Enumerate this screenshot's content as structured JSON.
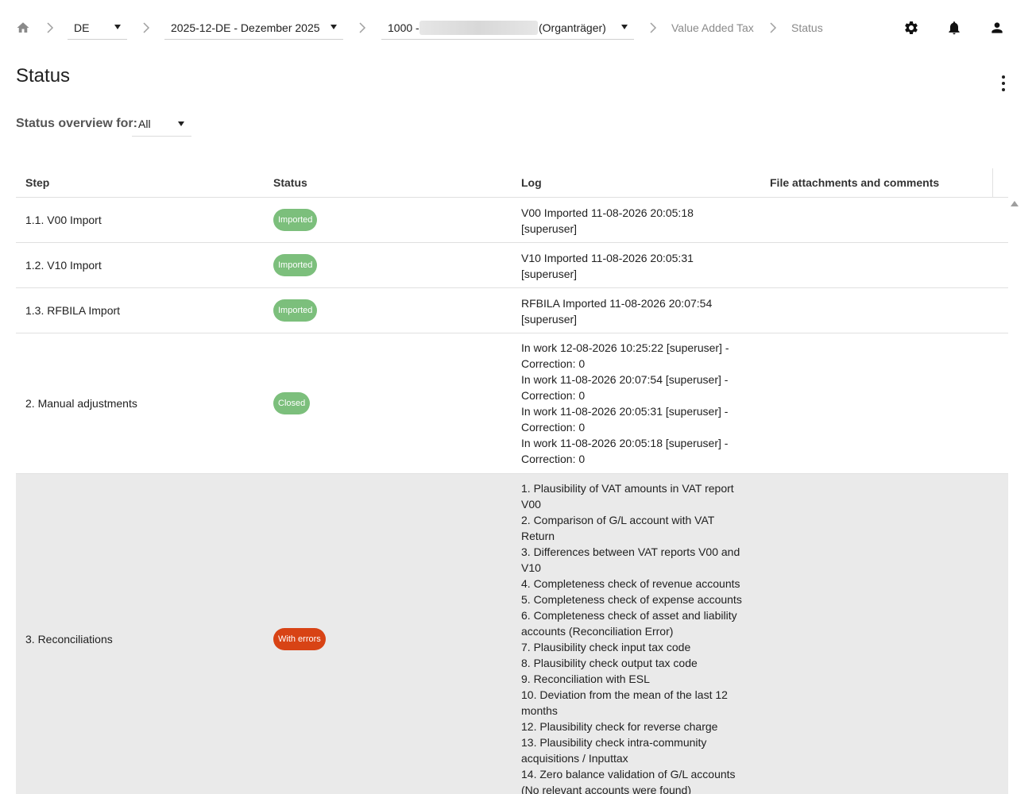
{
  "breadcrumb": {
    "country": "DE",
    "period": "2025-12-DE - Dezember 2025",
    "entity_prefix": "1000 -",
    "entity_suffix": "(Organträger)",
    "section": "Value Added Tax",
    "current": "Status"
  },
  "icons": {
    "home": "home-icon",
    "settings": "gear-icon",
    "notifications": "bell-icon",
    "profile": "user-icon",
    "menu": "more-vertical-icon"
  },
  "page": {
    "title": "Status"
  },
  "filter": {
    "label": "Status overview for:",
    "value": "All"
  },
  "table": {
    "headers": {
      "step": "Step",
      "status": "Status",
      "log": "Log",
      "attachments": "File attachments and comments"
    },
    "rows": [
      {
        "step": "1.1. V00 Import",
        "status": "Imported",
        "log": [
          "V00 Imported 11-08-2026 20:05:18",
          "[superuser]"
        ]
      },
      {
        "step": "1.2. V10 Import",
        "status": "Imported",
        "log": [
          "V10 Imported 11-08-2026 20:05:31",
          "[superuser]"
        ]
      },
      {
        "step": "1.3. RFBILA Import",
        "status": "Imported",
        "log": [
          "RFBILA Imported 11-08-2026 20:07:54",
          "[superuser]"
        ]
      },
      {
        "step": "2. Manual adjustments",
        "status": "Closed",
        "log": [
          "In work 12-08-2026 10:25:22 [superuser] -",
          "Correction: 0",
          "In work 11-08-2026 20:07:54 [superuser] -",
          "Correction: 0",
          "In work 11-08-2026 20:05:31 [superuser] -",
          "Correction: 0",
          "In work 11-08-2026 20:05:18 [superuser] -",
          "Correction: 0"
        ]
      },
      {
        "step": "3. Reconciliations",
        "status": "With errors",
        "log": [
          "1. Plausibility of VAT amounts in VAT report",
          "V00",
          "2. Comparison of G/L account with VAT",
          "Return",
          "3. Differences between VAT reports V00 and",
          "V10",
          "4. Completeness check of revenue accounts",
          "5. Completeness check of expense accounts",
          "6. Completeness check of asset and liability",
          "accounts (Reconciliation Error)",
          "7. Plausibility check input tax code",
          "8. Plausibility check output tax code",
          "9. Reconciliation with ESL",
          "10. Deviation from the mean of the last 12",
          "months",
          "12. Plausibility check for reverse charge",
          "13. Plausibility check intra-community",
          "acquisitions / Inputtax",
          "14. Zero balance validation of G/L accounts",
          "(No relevant accounts were found)"
        ]
      }
    ]
  },
  "colors": {
    "success": "#7cbf7c",
    "error": "#d84315",
    "row_highlight": "#eaeaea"
  }
}
